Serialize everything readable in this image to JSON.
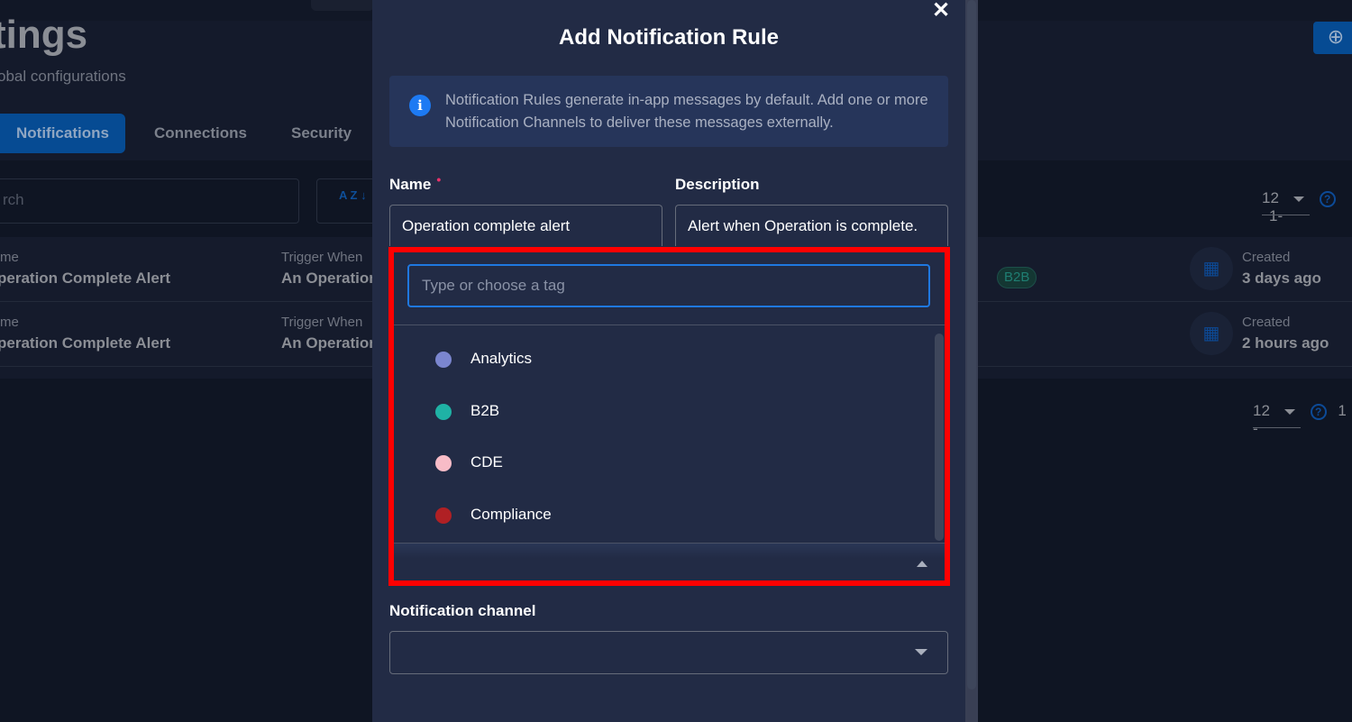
{
  "background": {
    "page_title": "tings",
    "page_subtitle": "obal configurations",
    "tabs": [
      {
        "label": "Notifications",
        "active": true
      },
      {
        "label": "Connections",
        "active": false
      },
      {
        "label": "Security",
        "active": false
      }
    ],
    "search_placeholder": "rch",
    "sort_icon_label": "A Z",
    "pagination_top": {
      "page_size": "12",
      "range": "1-"
    },
    "pagination_bottom": {
      "page_size": "12",
      "range": "1 -"
    },
    "rows": [
      {
        "name_label": "me",
        "name": "peration Complete Alert",
        "trigger_label": "Trigger When",
        "trigger": "An Operation",
        "tag": "B2B",
        "created_label": "Created",
        "created": "3 days ago"
      },
      {
        "name_label": "me",
        "name": "peration Complete Alert",
        "trigger_label": "Trigger When",
        "trigger": "An Operation",
        "created_label": "Created",
        "created": "2 hours ago"
      }
    ]
  },
  "modal": {
    "title": "Add Notification Rule",
    "info_text": "Notification Rules generate in-app messages by default. Add one or more Notification Channels to deliver these messages externally.",
    "name_label": "Name",
    "required_marker": "•",
    "name_value": "Operation complete alert",
    "description_label": "Description",
    "description_value": "Alert when Operation is complete.",
    "tag_input_placeholder": "Type or choose a tag",
    "tag_options": [
      {
        "label": "Analytics",
        "color": "#7b86cf"
      },
      {
        "label": "B2B",
        "color": "#1fb2a5"
      },
      {
        "label": "CDE",
        "color": "#f8bcc7"
      },
      {
        "label": "Compliance",
        "color": "#b02024"
      }
    ],
    "channel_label": "Notification channel",
    "channel_value": ""
  },
  "colors": {
    "accent": "#1f78e0",
    "highlight": "#ff0000",
    "modal_bg": "#222b45"
  }
}
